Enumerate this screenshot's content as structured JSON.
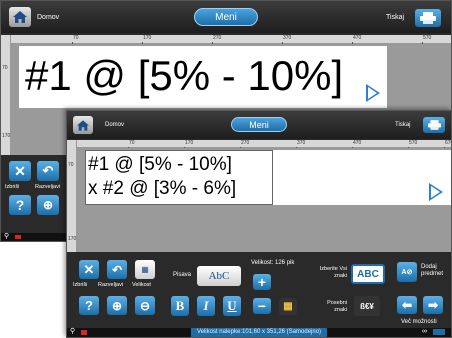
{
  "header": {
    "home_label": "Domov",
    "menu_label": "Meni",
    "print_label": "Tiskaj"
  },
  "ruler_ticks": [
    "70",
    "170",
    "270",
    "370",
    "470",
    "570",
    "670"
  ],
  "ruler_v_ticks": [
    "70",
    "170"
  ],
  "back_screen": {
    "text_line": "#1 @ [5% - 10%]",
    "actions": {
      "delete_label": "Izbriši",
      "undo_label": "Razveljavi"
    }
  },
  "front_screen": {
    "text_lines": [
      "#1 @ [5% - 10%]",
      "x #2 @ [3% - 6%]"
    ],
    "toolbar": {
      "delete_label": "Izbriši",
      "undo_label": "Razveljavi",
      "size_label": "Velikost",
      "font_label": "Pisava",
      "font_button_label": "AbC",
      "font_size_text": "Velikost: 126   pik",
      "plus_label": "+",
      "minus_label": "−",
      "bold_label": "B",
      "italic_label": "I",
      "underline_label": "U",
      "select_all_label": "Izberite Vsi znaki",
      "abc_label": "ABC",
      "special_chars_label": "Posebni znaki",
      "special_chars_glyph": "ß€¥",
      "add_object_label": "Dodaj predmet",
      "add_object_glyph": "A⊘",
      "more_options_label": "Več možnosti"
    },
    "status": "Velikost nalepke:101,60 x 351,26 (Samodejno)"
  },
  "colors": {
    "accent": "#1d6ea8",
    "dark": "#2a2a2a",
    "arrow": "#2f7fd0"
  }
}
